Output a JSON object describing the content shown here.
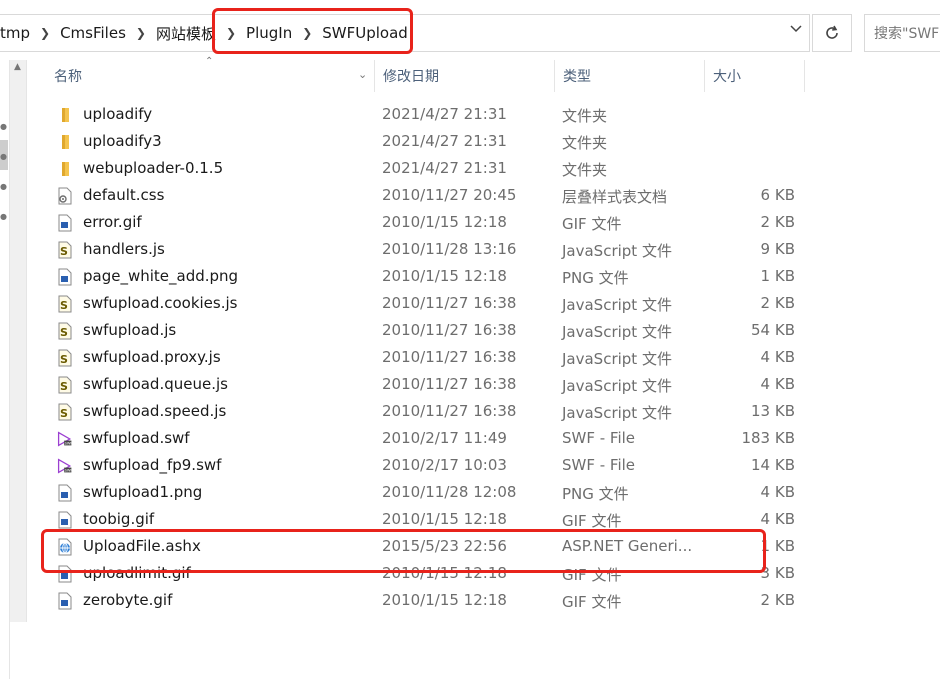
{
  "address_bar": {
    "crumbs": [
      "tmp",
      "CmsFiles",
      "网站模板",
      "PlugIn",
      "SWFUpload"
    ],
    "search_placeholder": "搜索\"SWFUpload\""
  },
  "columns": {
    "name": "名称",
    "date": "修改日期",
    "type": "类型",
    "size": "大小"
  },
  "files": [
    {
      "name": "uploadify",
      "date": "2021/4/27 21:31",
      "type": "文件夹",
      "size": "",
      "icon": "folder-icon"
    },
    {
      "name": "uploadify3",
      "date": "2021/4/27 21:31",
      "type": "文件夹",
      "size": "",
      "icon": "folder-icon"
    },
    {
      "name": "webuploader-0.1.5",
      "date": "2021/4/27 21:31",
      "type": "文件夹",
      "size": "",
      "icon": "folder-icon"
    },
    {
      "name": "default.css",
      "date": "2010/11/27 20:45",
      "type": "层叠样式表文档",
      "size": "6 KB",
      "icon": "css-file-icon"
    },
    {
      "name": "error.gif",
      "date": "2010/1/15 12:18",
      "type": "GIF 文件",
      "size": "2 KB",
      "icon": "image-file-icon"
    },
    {
      "name": "handlers.js",
      "date": "2010/11/28 13:16",
      "type": "JavaScript 文件",
      "size": "9 KB",
      "icon": "js-file-icon"
    },
    {
      "name": "page_white_add.png",
      "date": "2010/1/15 12:18",
      "type": "PNG 文件",
      "size": "1 KB",
      "icon": "image-file-icon"
    },
    {
      "name": "swfupload.cookies.js",
      "date": "2010/11/27 16:38",
      "type": "JavaScript 文件",
      "size": "2 KB",
      "icon": "js-file-icon"
    },
    {
      "name": "swfupload.js",
      "date": "2010/11/27 16:38",
      "type": "JavaScript 文件",
      "size": "54 KB",
      "icon": "js-file-icon"
    },
    {
      "name": "swfupload.proxy.js",
      "date": "2010/11/27 16:38",
      "type": "JavaScript 文件",
      "size": "4 KB",
      "icon": "js-file-icon"
    },
    {
      "name": "swfupload.queue.js",
      "date": "2010/11/27 16:38",
      "type": "JavaScript 文件",
      "size": "4 KB",
      "icon": "js-file-icon"
    },
    {
      "name": "swfupload.speed.js",
      "date": "2010/11/27 16:38",
      "type": "JavaScript 文件",
      "size": "13 KB",
      "icon": "js-file-icon"
    },
    {
      "name": "swfupload.swf",
      "date": "2010/2/17 11:49",
      "type": "SWF - File",
      "size": "183 KB",
      "icon": "swf-file-icon"
    },
    {
      "name": "swfupload_fp9.swf",
      "date": "2010/2/17 10:03",
      "type": "SWF - File",
      "size": "14 KB",
      "icon": "swf-file-icon"
    },
    {
      "name": "swfupload1.png",
      "date": "2010/11/28 12:08",
      "type": "PNG 文件",
      "size": "4 KB",
      "icon": "image-file-icon"
    },
    {
      "name": "toobig.gif",
      "date": "2010/1/15 12:18",
      "type": "GIF 文件",
      "size": "4 KB",
      "icon": "image-file-icon"
    },
    {
      "name": "UploadFile.ashx",
      "date": "2015/5/23 22:56",
      "type": "ASP.NET Generi...",
      "size": "1 KB",
      "icon": "web-file-icon"
    },
    {
      "name": "uploadlimit.gif",
      "date": "2010/1/15 12:18",
      "type": "GIF 文件",
      "size": "3 KB",
      "icon": "image-file-icon"
    },
    {
      "name": "zerobyte.gif",
      "date": "2010/1/15 12:18",
      "type": "GIF 文件",
      "size": "2 KB",
      "icon": "image-file-icon"
    }
  ],
  "colors": {
    "highlight": "#e8231b",
    "header_text": "#4c607a",
    "folder": "#f4c44e"
  }
}
